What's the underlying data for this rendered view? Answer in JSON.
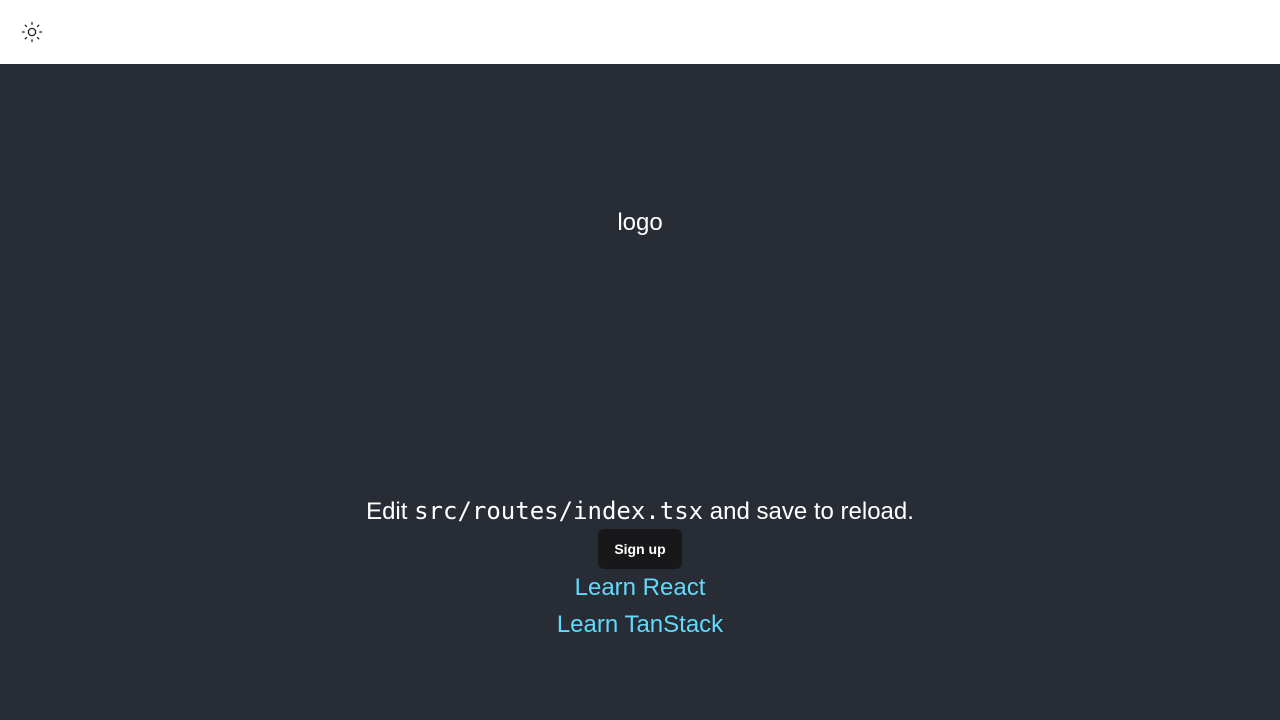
{
  "header": {
    "theme_toggle_icon": "sun-icon"
  },
  "main": {
    "logo_alt": "logo",
    "edit_prefix": "Edit ",
    "edit_code": "src/routes/index.tsx",
    "edit_suffix": " and save to reload.",
    "signup_label": "Sign up",
    "links": [
      {
        "label": "Learn React"
      },
      {
        "label": "Learn TanStack"
      }
    ]
  },
  "colors": {
    "header_bg": "#ffffff",
    "main_bg": "#282c34",
    "link": "#61dafb",
    "button_bg": "#18181b"
  }
}
